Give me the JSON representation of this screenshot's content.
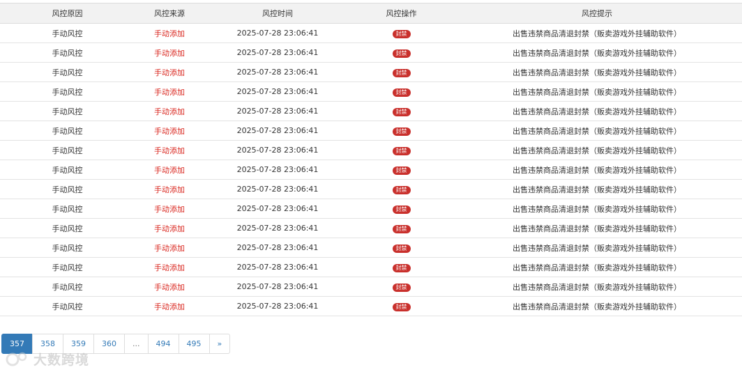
{
  "table": {
    "headers": [
      "风控原因",
      "风控来源",
      "风控时间",
      "风控操作",
      "风控提示"
    ],
    "rows": [
      {
        "reason": "手动风控",
        "source": "手动添加",
        "time": "2025-07-28 23:06:41",
        "action": "封禁",
        "tip": "出售违禁商品清退封禁（贩卖游戏外挂辅助软件）"
      },
      {
        "reason": "手动风控",
        "source": "手动添加",
        "time": "2025-07-28 23:06:41",
        "action": "封禁",
        "tip": "出售违禁商品清退封禁（贩卖游戏外挂辅助软件）"
      },
      {
        "reason": "手动风控",
        "source": "手动添加",
        "time": "2025-07-28 23:06:41",
        "action": "封禁",
        "tip": "出售违禁商品清退封禁（贩卖游戏外挂辅助软件）"
      },
      {
        "reason": "手动风控",
        "source": "手动添加",
        "time": "2025-07-28 23:06:41",
        "action": "封禁",
        "tip": "出售违禁商品清退封禁（贩卖游戏外挂辅助软件）"
      },
      {
        "reason": "手动风控",
        "source": "手动添加",
        "time": "2025-07-28 23:06:41",
        "action": "封禁",
        "tip": "出售违禁商品清退封禁（贩卖游戏外挂辅助软件）"
      },
      {
        "reason": "手动风控",
        "source": "手动添加",
        "time": "2025-07-28 23:06:41",
        "action": "封禁",
        "tip": "出售违禁商品清退封禁（贩卖游戏外挂辅助软件）"
      },
      {
        "reason": "手动风控",
        "source": "手动添加",
        "time": "2025-07-28 23:06:41",
        "action": "封禁",
        "tip": "出售违禁商品清退封禁（贩卖游戏外挂辅助软件）"
      },
      {
        "reason": "手动风控",
        "source": "手动添加",
        "time": "2025-07-28 23:06:41",
        "action": "封禁",
        "tip": "出售违禁商品清退封禁（贩卖游戏外挂辅助软件）"
      },
      {
        "reason": "手动风控",
        "source": "手动添加",
        "time": "2025-07-28 23:06:41",
        "action": "封禁",
        "tip": "出售违禁商品清退封禁（贩卖游戏外挂辅助软件）"
      },
      {
        "reason": "手动风控",
        "source": "手动添加",
        "time": "2025-07-28 23:06:41",
        "action": "封禁",
        "tip": "出售违禁商品清退封禁（贩卖游戏外挂辅助软件）"
      },
      {
        "reason": "手动风控",
        "source": "手动添加",
        "time": "2025-07-28 23:06:41",
        "action": "封禁",
        "tip": "出售违禁商品清退封禁（贩卖游戏外挂辅助软件）"
      },
      {
        "reason": "手动风控",
        "source": "手动添加",
        "time": "2025-07-28 23:06:41",
        "action": "封禁",
        "tip": "出售违禁商品清退封禁（贩卖游戏外挂辅助软件）"
      },
      {
        "reason": "手动风控",
        "source": "手动添加",
        "time": "2025-07-28 23:06:41",
        "action": "封禁",
        "tip": "出售违禁商品清退封禁（贩卖游戏外挂辅助软件）"
      },
      {
        "reason": "手动风控",
        "source": "手动添加",
        "time": "2025-07-28 23:06:41",
        "action": "封禁",
        "tip": "出售违禁商品清退封禁（贩卖游戏外挂辅助软件）"
      },
      {
        "reason": "手动风控",
        "source": "手动添加",
        "time": "2025-07-28 23:06:41",
        "action": "封禁",
        "tip": "出售违禁商品清退封禁（贩卖游戏外挂辅助软件）"
      }
    ]
  },
  "pagination": {
    "pages": [
      {
        "label": "357",
        "active": true
      },
      {
        "label": "358",
        "active": false
      },
      {
        "label": "359",
        "active": false
      },
      {
        "label": "360",
        "active": false
      },
      {
        "label": "...",
        "active": false,
        "ellipsis": true
      },
      {
        "label": "494",
        "active": false
      },
      {
        "label": "495",
        "active": false
      },
      {
        "label": "»",
        "active": false
      }
    ]
  },
  "watermark": {
    "text": "大数跨境"
  },
  "colors": {
    "source_red": "#d9241c",
    "badge_red": "#c9302c",
    "pager_active": "#337ab7"
  }
}
